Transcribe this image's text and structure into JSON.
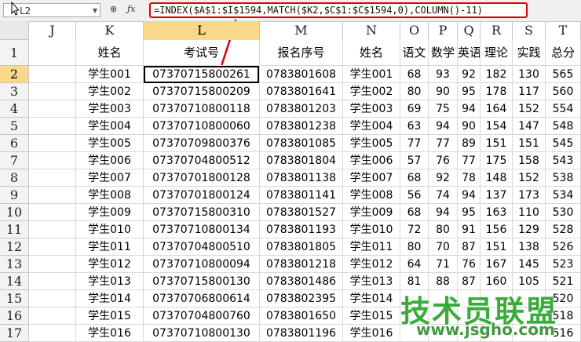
{
  "formula_bar": {
    "cell_ref": "L2",
    "formula": "=INDEX($A$1:$I$1594,MATCH($K2,$C$1:$C$1594,0),COLUMN()-11)"
  },
  "columns": [
    "J",
    "K",
    "L",
    "M",
    "N",
    "O",
    "P",
    "Q",
    "R",
    "S",
    "T"
  ],
  "headers": [
    "",
    "姓名",
    "考试号",
    "报名序号",
    "姓名",
    "语文",
    "数学",
    "英语",
    "理论",
    "实践",
    "总分"
  ],
  "rows": [
    {
      "num": "2",
      "cells": [
        "",
        "学生001",
        "07370715800261",
        "0783801608",
        "学生001",
        "68",
        "93",
        "92",
        "182",
        "130",
        "565"
      ]
    },
    {
      "num": "3",
      "cells": [
        "",
        "学生002",
        "07370715800209",
        "0783801641",
        "学生002",
        "80",
        "90",
        "95",
        "178",
        "117",
        "560"
      ]
    },
    {
      "num": "4",
      "cells": [
        "",
        "学生003",
        "07370710800118",
        "0783801203",
        "学生003",
        "69",
        "75",
        "94",
        "164",
        "152",
        "554"
      ]
    },
    {
      "num": "5",
      "cells": [
        "",
        "学生004",
        "07370710800060",
        "0783801238",
        "学生004",
        "63",
        "94",
        "90",
        "154",
        "147",
        "548"
      ]
    },
    {
      "num": "6",
      "cells": [
        "",
        "学生005",
        "07370709800376",
        "0783801085",
        "学生005",
        "77",
        "77",
        "89",
        "151",
        "151",
        "545"
      ]
    },
    {
      "num": "7",
      "cells": [
        "",
        "学生006",
        "07370704800512",
        "0783801804",
        "学生006",
        "57",
        "76",
        "77",
        "175",
        "158",
        "543"
      ]
    },
    {
      "num": "8",
      "cells": [
        "",
        "学生007",
        "07370701800128",
        "0783801138",
        "学生007",
        "68",
        "92",
        "78",
        "148",
        "152",
        "538"
      ]
    },
    {
      "num": "9",
      "cells": [
        "",
        "学生008",
        "07370701800124",
        "0783801141",
        "学生008",
        "56",
        "74",
        "94",
        "137",
        "173",
        "534"
      ]
    },
    {
      "num": "10",
      "cells": [
        "",
        "学生009",
        "07370715800310",
        "0783801527",
        "学生009",
        "68",
        "94",
        "95",
        "163",
        "110",
        "530"
      ]
    },
    {
      "num": "11",
      "cells": [
        "",
        "学生010",
        "07370710800134",
        "0783801193",
        "学生010",
        "72",
        "80",
        "91",
        "156",
        "129",
        "528"
      ]
    },
    {
      "num": "12",
      "cells": [
        "",
        "学生011",
        "07370704800510",
        "0783801805",
        "学生011",
        "80",
        "70",
        "87",
        "151",
        "138",
        "526"
      ]
    },
    {
      "num": "13",
      "cells": [
        "",
        "学生012",
        "07370710800094",
        "0783801218",
        "学生012",
        "64",
        "71",
        "76",
        "167",
        "145",
        "523"
      ]
    },
    {
      "num": "14",
      "cells": [
        "",
        "学生013",
        "07370715800130",
        "0783801486",
        "学生013",
        "81",
        "88",
        "87",
        "160",
        "105",
        "521"
      ]
    },
    {
      "num": "15",
      "cells": [
        "",
        "学生014",
        "07370706800614",
        "0783802395",
        "学生014",
        "",
        "",
        "",
        "",
        "",
        "520"
      ]
    },
    {
      "num": "16",
      "cells": [
        "",
        "学生015",
        "07370704800760",
        "0783801650",
        "学生015",
        "",
        "",
        "",
        "",
        "",
        "518"
      ]
    },
    {
      "num": "17",
      "cells": [
        "",
        "学生016",
        "07370710800130",
        "0783801196",
        "学生016",
        "",
        "",
        "",
        "",
        "",
        "516"
      ]
    }
  ],
  "watermark": {
    "title": "技术员联盟",
    "url": "www.jsgho.com"
  },
  "colors": {
    "formula_border": "#e00000",
    "active_header": "#f9d88a",
    "watermark": "#2aa52a"
  }
}
